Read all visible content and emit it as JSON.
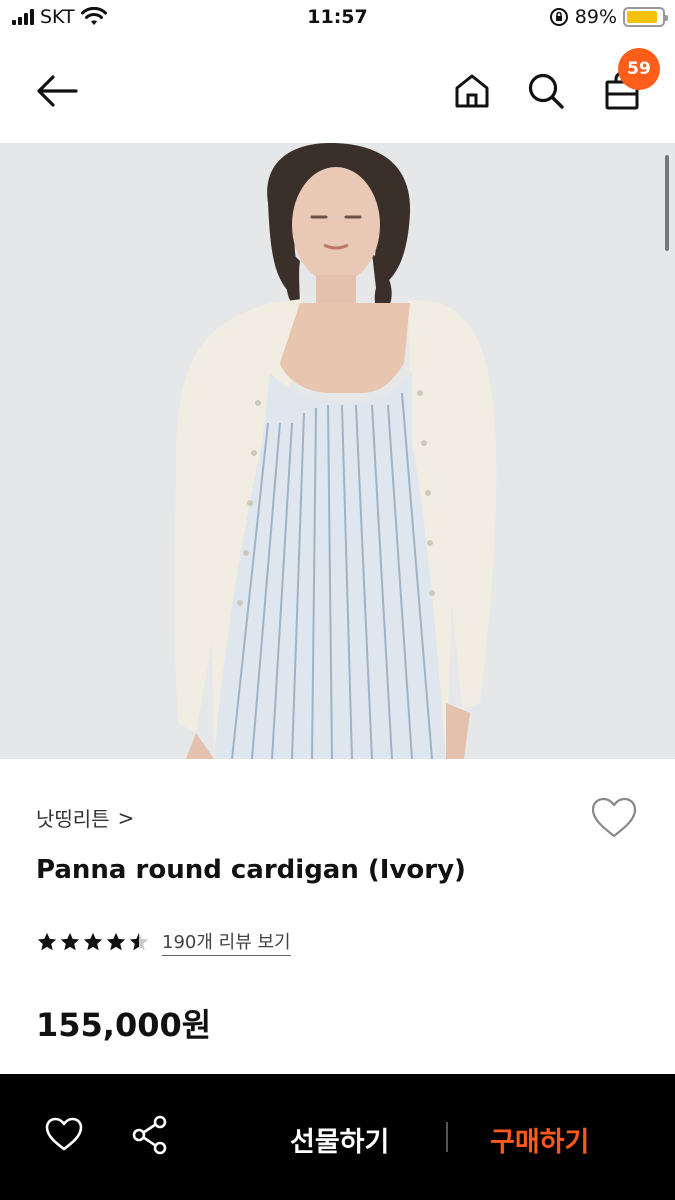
{
  "status_bar": {
    "carrier": "SKT",
    "time": "11:57",
    "battery_percent": "89%",
    "battery_level": 0.89,
    "battery_color": "#f4c20d"
  },
  "nav": {
    "back_icon": "arrow-left-icon",
    "home_icon": "home-icon",
    "search_icon": "search-icon",
    "bag_icon": "shopping-bag-icon",
    "cart_count": "59",
    "badge_color": "#ff5e1a"
  },
  "product": {
    "brand": "낫띵리튼",
    "brand_chevron": ">",
    "title": "Panna round cardigan (Ivory)",
    "rating": 4.5,
    "review_link": "190개 리뷰 보기",
    "price": "155,000원",
    "image_alt": "model wearing ivory cardigan over striped dress"
  },
  "bottom_bar": {
    "gift_label": "선물하기",
    "buy_label": "구매하기",
    "buy_color": "#ff5a1a"
  }
}
